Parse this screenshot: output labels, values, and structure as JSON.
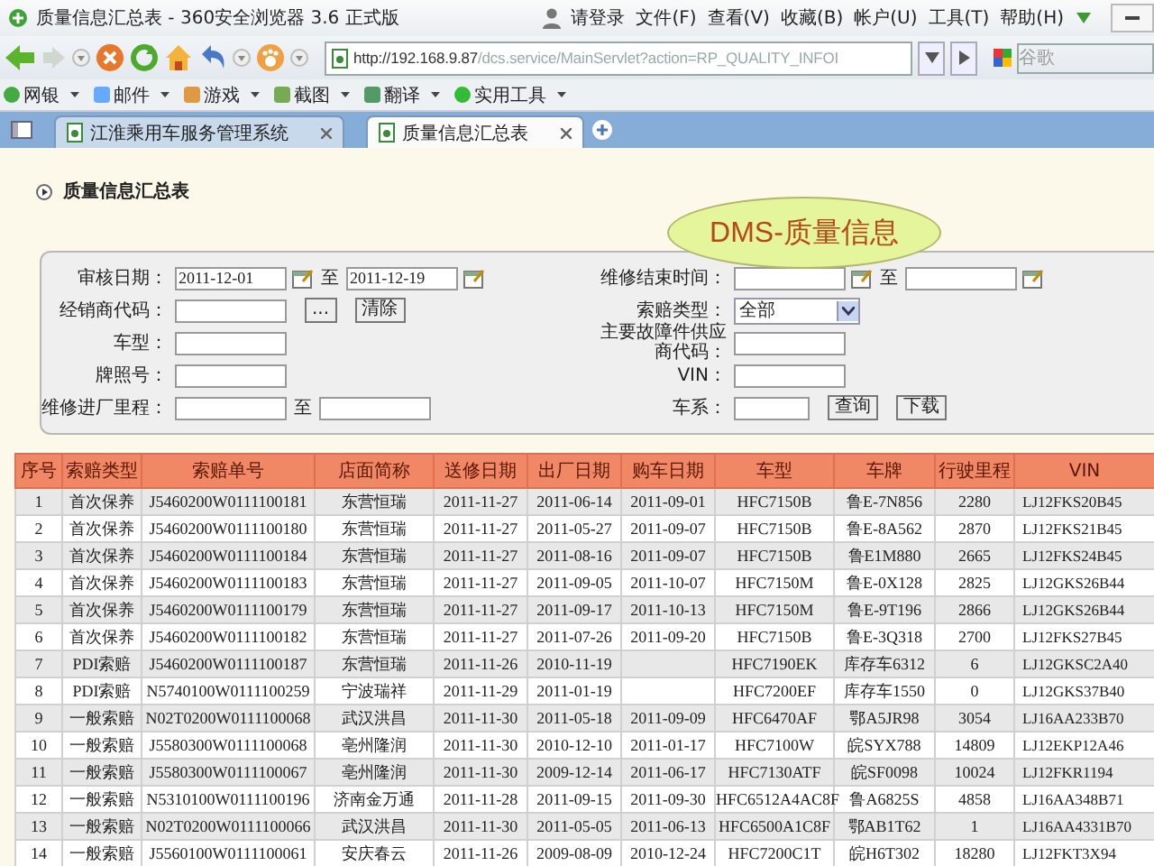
{
  "window": {
    "title": "质量信息汇总表 - 360安全浏览器 3.6 正式版"
  },
  "menu": [
    {
      "label": "请登录",
      "kind": "user"
    },
    {
      "label": "文件(F)",
      "kind": "plain"
    },
    {
      "label": "查看(V)",
      "kind": "plain"
    },
    {
      "label": "收藏(B)",
      "kind": "plain"
    },
    {
      "label": "帐户(U)",
      "kind": "plain"
    },
    {
      "label": "工具(T)",
      "kind": "plain"
    },
    {
      "label": "帮助(H)",
      "kind": "plain"
    }
  ],
  "nav": {
    "address_host": "http://192.168.9.87",
    "address_path": "/dcs.service/MainServlet?action=RP_QUALITY_INFOI",
    "search_placeholder": "谷歌"
  },
  "bookmarks": [
    {
      "label": "网银"
    },
    {
      "label": "邮件"
    },
    {
      "label": "游戏"
    },
    {
      "label": "截图"
    },
    {
      "label": "翻译"
    },
    {
      "label": "实用工具"
    }
  ],
  "tabs": [
    {
      "label": "江淮乘用车服务管理系统",
      "selected": false
    },
    {
      "label": "质量信息汇总表",
      "selected": true
    }
  ],
  "page": {
    "heading": "质量信息汇总表",
    "badge": "DMS-质量信息"
  },
  "form": {
    "rows": [
      {
        "left": {
          "label": "审核日期：",
          "kind": "date_range",
          "from": "2011-12-01",
          "sep": "至",
          "to": "2011-12-19"
        },
        "right": {
          "label": "维修结束时间：",
          "kind": "date_range",
          "sep": "至"
        }
      },
      {
        "left": {
          "label": "经销商代码：",
          "kind": "text",
          "buttons": [
            "...",
            "清除"
          ]
        },
        "right": {
          "label": "索赔类型：",
          "kind": "select",
          "value": "全部"
        }
      },
      {
        "left": {
          "label": "车型：",
          "kind": "text"
        },
        "right": {
          "label": "主要故障件供应商代码：",
          "kind": "text"
        }
      },
      {
        "left": {
          "label": "牌照号：",
          "kind": "text"
        },
        "right": {
          "label": "VIN：",
          "kind": "text"
        }
      },
      {
        "left": {
          "label": "维修进厂里程：",
          "kind": "text_range",
          "sep": "至"
        },
        "right": {
          "label": "车系：",
          "kind": "text_short",
          "buttons": [
            "查询",
            "下载"
          ]
        }
      }
    ]
  },
  "table": {
    "columns": [
      "序号",
      "索赔类型",
      "索赔单号",
      "店面简称",
      "送修日期",
      "出厂日期",
      "购车日期",
      "车型",
      "车牌",
      "行驶里程",
      "VIN"
    ],
    "rows": [
      [
        "1",
        "首次保养",
        "J5460200W0111100181",
        "东营恒瑞",
        "2011-11-27",
        "2011-06-14",
        "2011-09-01",
        "HFC7150B",
        "鲁E-7N856",
        "2280",
        "LJ12FKS20B45"
      ],
      [
        "2",
        "首次保养",
        "J5460200W0111100180",
        "东营恒瑞",
        "2011-11-27",
        "2011-05-27",
        "2011-09-07",
        "HFC7150B",
        "鲁E-8A562",
        "2870",
        "LJ12FKS21B45"
      ],
      [
        "3",
        "首次保养",
        "J5460200W0111100184",
        "东营恒瑞",
        "2011-11-27",
        "2011-08-16",
        "2011-09-07",
        "HFC7150B",
        "鲁E1M880",
        "2665",
        "LJ12FKS24B45"
      ],
      [
        "4",
        "首次保养",
        "J5460200W0111100183",
        "东营恒瑞",
        "2011-11-27",
        "2011-09-05",
        "2011-10-07",
        "HFC7150M",
        "鲁E-0X128",
        "2825",
        "LJ12GKS26B44"
      ],
      [
        "5",
        "首次保养",
        "J5460200W0111100179",
        "东营恒瑞",
        "2011-11-27",
        "2011-09-17",
        "2011-10-13",
        "HFC7150M",
        "鲁E-9T196",
        "2866",
        "LJ12GKS26B44"
      ],
      [
        "6",
        "首次保养",
        "J5460200W0111100182",
        "东营恒瑞",
        "2011-11-27",
        "2011-07-26",
        "2011-09-20",
        "HFC7150B",
        "鲁E-3Q318",
        "2700",
        "LJ12FKS27B45"
      ],
      [
        "7",
        "PDI索赔",
        "J5460200W0111100187",
        "东营恒瑞",
        "2011-11-26",
        "2010-11-19",
        "",
        "HFC7190EK",
        "库存车6312",
        "6",
        "LJ12GKSC2A40"
      ],
      [
        "8",
        "PDI索赔",
        "N5740100W0111100259",
        "宁波瑞祥",
        "2011-11-29",
        "2011-01-19",
        "",
        "HFC7200EF",
        "库存车1550",
        "0",
        "LJ12GKS37B40"
      ],
      [
        "9",
        "一般索赔",
        "N02T0200W0111100068",
        "武汉洪昌",
        "2011-11-30",
        "2011-05-18",
        "2011-09-09",
        "HFC6470AF",
        "鄂A5JR98",
        "3054",
        "LJ16AA233B70"
      ],
      [
        "10",
        "一般索赔",
        "J5580300W0111100068",
        "亳州隆润",
        "2011-11-30",
        "2010-12-10",
        "2011-01-17",
        "HFC7100W",
        "皖SYX788",
        "14809",
        "LJ12EKP12A46"
      ],
      [
        "11",
        "一般索赔",
        "J5580300W0111100067",
        "亳州隆润",
        "2011-11-30",
        "2009-12-14",
        "2011-06-17",
        "HFC7130ATF",
        "皖SF0098",
        "10024",
        "LJ12FKR1194"
      ],
      [
        "12",
        "一般索赔",
        "N5310100W0111100196",
        "济南金万通",
        "2011-11-28",
        "2011-09-15",
        "2011-09-30",
        "HFC6512A4AC8F",
        "鲁A6825S",
        "4858",
        "LJ16AA348B71"
      ],
      [
        "13",
        "一般索赔",
        "N02T0200W0111100066",
        "武汉洪昌",
        "2011-11-30",
        "2011-05-05",
        "2011-06-13",
        "HFC6500A1C8F",
        "鄂AB1T62",
        "1",
        "LJ16AA4331B70"
      ],
      [
        "14",
        "一般索赔",
        "J5560100W0111100061",
        "安庆春云",
        "2011-11-26",
        "2009-08-09",
        "2010-12-24",
        "HFC7200C1T",
        "皖H6T302",
        "18280",
        "LJ12FKT3X94"
      ]
    ]
  }
}
